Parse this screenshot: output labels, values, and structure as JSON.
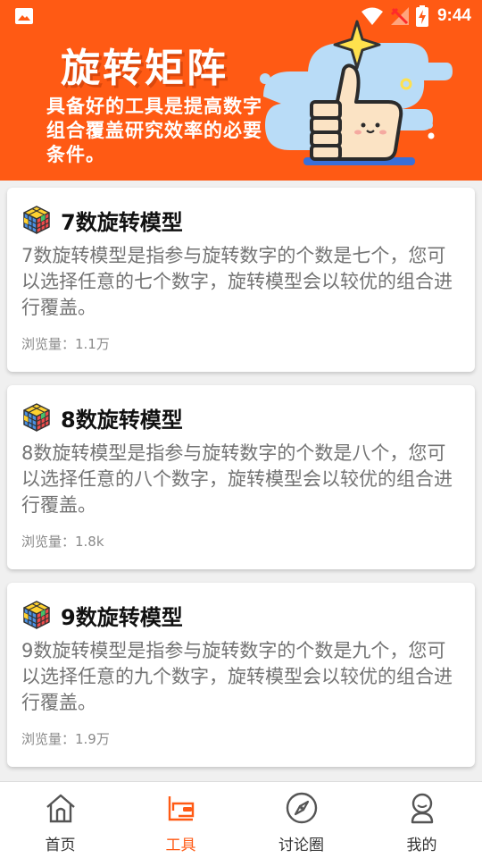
{
  "status_bar": {
    "time": "9:44",
    "icons": [
      "image-icon",
      "wifi-icon",
      "signal-icon",
      "battery-charging-icon"
    ]
  },
  "header": {
    "title": "旋转矩阵",
    "subtitle": "具备好的工具是提高数字组合覆盖研究效率的必要条件。",
    "background_color": "#ff5a14"
  },
  "cards": [
    {
      "icon": "rubiks-cube-icon",
      "title": "7数旋转模型",
      "description": "7数旋转模型是指参与旋转数字的个数是七个，您可以选择任意的七个数字，旋转模型会以较优的组合进行覆盖。",
      "views": "浏览量：1.1万"
    },
    {
      "icon": "rubiks-cube-icon",
      "title": "8数旋转模型",
      "description": "8数旋转模型是指参与旋转数字的个数是八个，您可以选择任意的八个数字，旋转模型会以较优的组合进行覆盖。",
      "views": "浏览量：1.8k"
    },
    {
      "icon": "rubiks-cube-icon",
      "title": "9数旋转模型",
      "description": "9数旋转模型是指参与旋转数字的个数是九个，您可以选择任意的九个数字，旋转模型会以较优的组合进行覆盖。",
      "views": "浏览量：1.9万"
    }
  ],
  "bottom_nav": {
    "items": [
      {
        "label": "首页",
        "icon": "home-icon",
        "active": false
      },
      {
        "label": "工具",
        "icon": "tools-icon",
        "active": true
      },
      {
        "label": "讨论圈",
        "icon": "compass-icon",
        "active": false
      },
      {
        "label": "我的",
        "icon": "profile-icon",
        "active": false
      }
    ],
    "active_color": "#ff5a14"
  }
}
